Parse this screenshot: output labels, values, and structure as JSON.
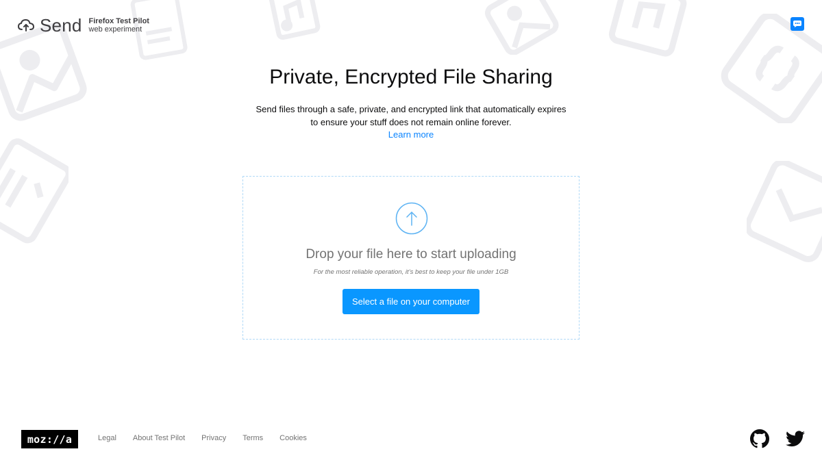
{
  "header": {
    "logo_text": "Send",
    "test_pilot_title": "Firefox Test Pilot",
    "test_pilot_subtitle": "web experiment",
    "feedback_icon": "chat-bubble-icon"
  },
  "hero": {
    "title": "Private, Encrypted File Sharing",
    "description": "Send files through a safe, private, and encrypted link that automatically expires to ensure your stuff does not remain online forever.",
    "learn_more": "Learn more"
  },
  "upload": {
    "icon": "upload-arrow-icon",
    "title": "Drop your file here to start uploading",
    "note": "For the most reliable operation, it’s best to keep your file under 1GB",
    "button_label": "Select a file on your computer"
  },
  "footer": {
    "mozilla_logo": "moz://a",
    "links": [
      "Legal",
      "About Test Pilot",
      "Privacy",
      "Terms",
      "Cookies"
    ],
    "social_icons": [
      "github-icon",
      "twitter-icon"
    ]
  },
  "colors": {
    "accent": "#0a84ff",
    "button": "#0a97ff",
    "upload_border": "#b0d9f7",
    "muted_text": "#737373",
    "background_icons": "#ededf0"
  }
}
